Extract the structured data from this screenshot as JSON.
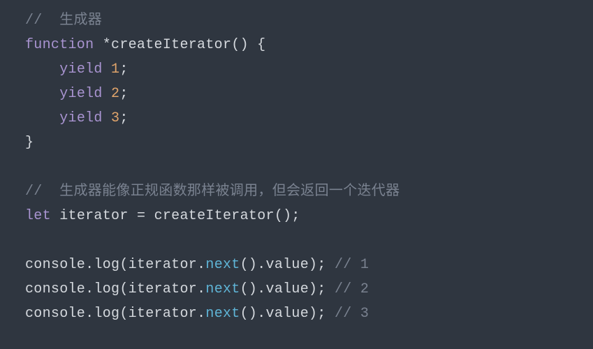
{
  "code": {
    "line1": {
      "comment": "//  生成器"
    },
    "line2": {
      "kw_function": "function",
      "star": " *",
      "fname": "createIterator",
      "paren": "()",
      "brace_open": " {"
    },
    "line3": {
      "indent": "    ",
      "yield": "yield",
      "sp": " ",
      "num": "1",
      "semi": ";"
    },
    "line4": {
      "indent": "    ",
      "yield": "yield",
      "sp": " ",
      "num": "2",
      "semi": ";"
    },
    "line5": {
      "indent": "    ",
      "yield": "yield",
      "sp": " ",
      "num": "3",
      "semi": ";"
    },
    "line6": {
      "brace_close": "}"
    },
    "line8": {
      "comment": "//  生成器能像正规函数那样被调用，但会返回一个迭代器"
    },
    "line9": {
      "let": "let",
      "sp1": " ",
      "ident": "iterator",
      "sp2": " ",
      "eq": "=",
      "sp3": " ",
      "fname": "createIterator",
      "paren": "()",
      "semi": ";"
    },
    "line11": {
      "console": "console",
      "dot1": ".",
      "log": "log",
      "open": "(",
      "iter": "iterator",
      "dot2": ".",
      "next": "next",
      "call": "()",
      "dot3": ".",
      "value": "value",
      "close": ")",
      "semi": ";",
      "sp": " ",
      "comment": "// 1"
    },
    "line12": {
      "console": "console",
      "dot1": ".",
      "log": "log",
      "open": "(",
      "iter": "iterator",
      "dot2": ".",
      "next": "next",
      "call": "()",
      "dot3": ".",
      "value": "value",
      "close": ")",
      "semi": ";",
      "sp": " ",
      "comment": "// 2"
    },
    "line13": {
      "console": "console",
      "dot1": ".",
      "log": "log",
      "open": "(",
      "iter": "iterator",
      "dot2": ".",
      "next": "next",
      "call": "()",
      "dot3": ".",
      "value": "value",
      "close": ")",
      "semi": ";",
      "sp": " ",
      "comment": "// 3"
    }
  }
}
